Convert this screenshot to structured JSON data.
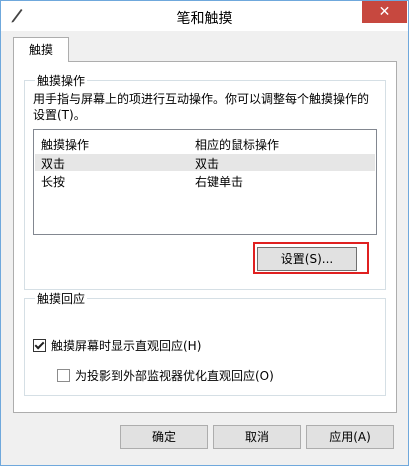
{
  "window": {
    "title": "笔和触摸",
    "close_glyph": "✕"
  },
  "tab": {
    "label": "触摸"
  },
  "touch_group": {
    "title": "触摸操作",
    "description": "用手指与屏幕上的项进行互动操作。你可以调整每个触摸操作的设置(T)。",
    "columns": [
      "触摸操作",
      "相应的鼠标操作"
    ],
    "rows": [
      {
        "action": "双击",
        "mouse": "双击",
        "selected": true
      },
      {
        "action": "长按",
        "mouse": "右键单击",
        "selected": false
      }
    ],
    "settings_button": "设置(S)..."
  },
  "feedback_group": {
    "title": "触摸回应",
    "show_feedback": {
      "label": "触摸屏幕时显示直观回应(H)",
      "checked": true
    },
    "optimize_projector": {
      "label": "为投影到外部监视器优化直观回应(O)",
      "checked": false
    }
  },
  "buttons": {
    "ok": "确定",
    "cancel": "取消",
    "apply": "应用(A)"
  }
}
